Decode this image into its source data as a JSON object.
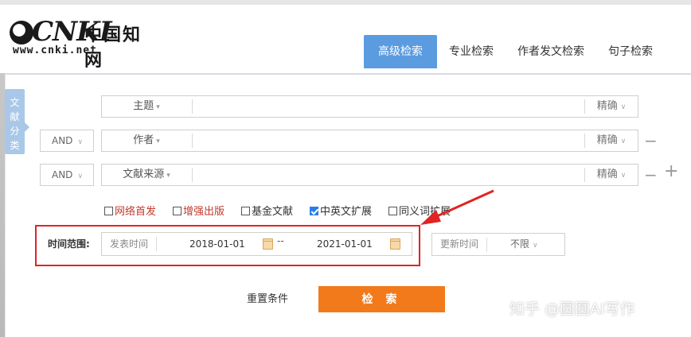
{
  "logo": {
    "brand": "CNKI",
    "cn_name": "中国知网",
    "url": "www.cnki.net"
  },
  "tabs": [
    {
      "label": "高级检索",
      "active": true
    },
    {
      "label": "专业检索",
      "active": false
    },
    {
      "label": "作者发文检索",
      "active": false
    },
    {
      "label": "句子检索",
      "active": false
    }
  ],
  "side_tab": {
    "chars": [
      "文",
      "献",
      "分",
      "类"
    ]
  },
  "rows": [
    {
      "logic": "",
      "field": "主题",
      "mode": "精确"
    },
    {
      "logic": "AND",
      "field": "作者",
      "mode": "精确"
    },
    {
      "logic": "AND",
      "field": "文献来源",
      "mode": "精确"
    }
  ],
  "ops": {
    "minus": "−",
    "plus": "+"
  },
  "checkboxes": [
    {
      "label": "网络首发",
      "checked": false,
      "color": "#c0392b"
    },
    {
      "label": "增强出版",
      "checked": false,
      "color": "#c0392b"
    },
    {
      "label": "基金文献",
      "checked": false,
      "color": "#333333"
    },
    {
      "label": "中英文扩展",
      "checked": true,
      "color": "#333333"
    },
    {
      "label": "同义词扩展",
      "checked": false,
      "color": "#333333"
    }
  ],
  "time": {
    "label": "时间范围:",
    "type": "发表时间",
    "from": "2018-01-01",
    "dash": "--",
    "to": "2021-01-01"
  },
  "update": {
    "label": "更新时间",
    "value": "不限"
  },
  "buttons": {
    "reset": "重置条件",
    "search": "检 索"
  },
  "watermark": "知乎 @圆圆AI写作",
  "colors": {
    "accent": "#5b9bdf",
    "search": "#f27a1a",
    "highlight": "#e02424"
  }
}
